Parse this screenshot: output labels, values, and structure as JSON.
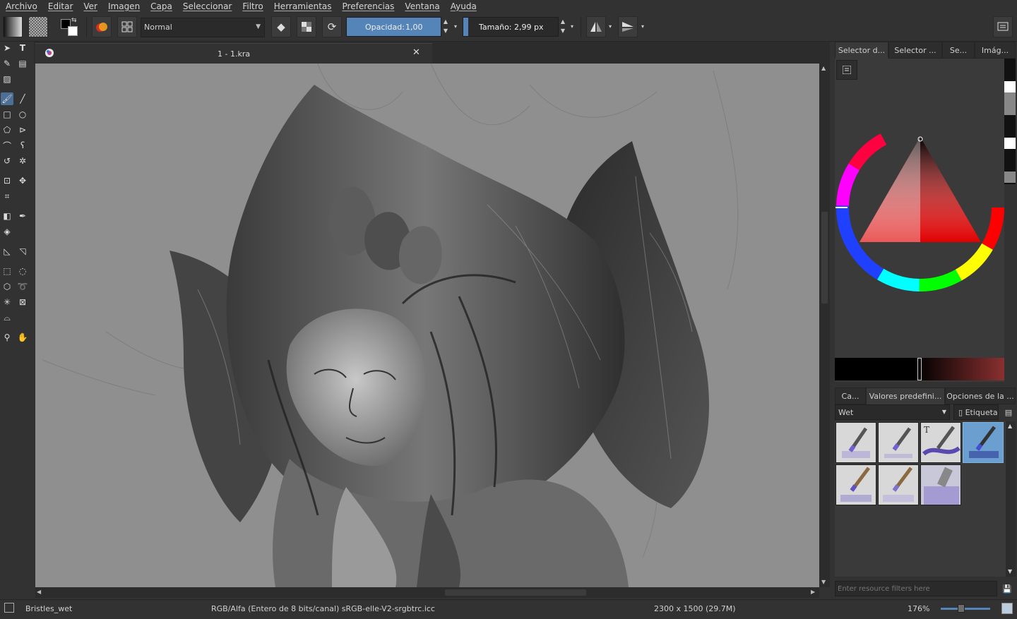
{
  "menu": [
    "Archivo",
    "Editar",
    "Ver",
    "Imagen",
    "Capa",
    "Seleccionar",
    "Filtro",
    "Herramientas",
    "Preferencias",
    "Ventana",
    "Ayuda"
  ],
  "toolbar": {
    "blend_mode": "Normal",
    "opacity_label": "Opacidad:",
    "opacity_value": "1,00",
    "opacity_fraction": 1.0,
    "size_label": "Tamaño:",
    "size_value": "2,99 px",
    "size_fraction": 0.05
  },
  "document": {
    "tab_title": "1 - 1.kra"
  },
  "dock": {
    "top_tabs": [
      "Selector d...",
      "Selector ...",
      "Se...",
      "Imág..."
    ],
    "bottom_tabs": [
      "Ca...",
      "Valores predefini...",
      "Opciones de la ..."
    ],
    "preset_tag": "Wet",
    "tag_button": "Etiqueta",
    "filter_placeholder": "Enter resource filters here",
    "active_color": "#e00000"
  },
  "status": {
    "brush": "Bristles_wet",
    "color_space": "RGB/Alfa (Entero de 8 bits/canal)  sRGB-elle-V2-srgbtrc.icc",
    "dimensions": "2300 x 1500 (29.7M)",
    "zoom": "176%",
    "zoom_fraction": 0.42
  },
  "colors": {
    "accent": "#4b6f96",
    "slider_fill": "#5585b8",
    "panel_bg": "#323232",
    "canvas_bg": "#8f8f8f"
  }
}
